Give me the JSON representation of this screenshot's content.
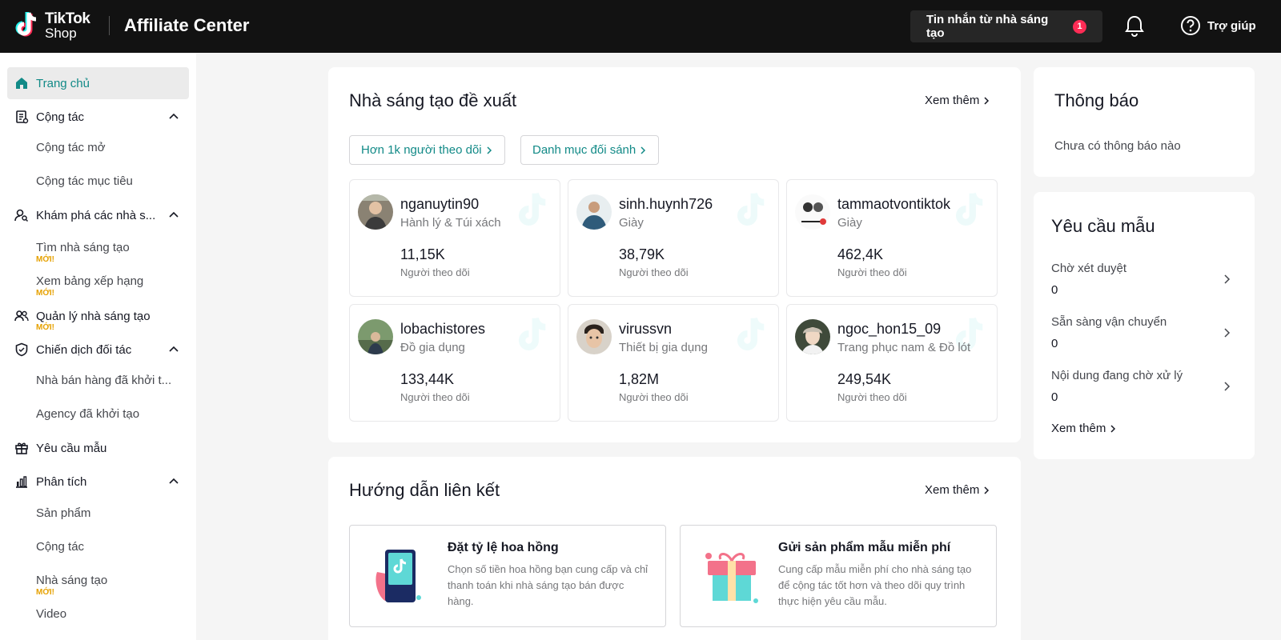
{
  "header": {
    "logo_line1": "TikTok",
    "logo_line2": "Shop",
    "app_title": "Affiliate Center",
    "messages_label": "Tin nhắn từ nhà sáng tạo",
    "messages_count": "1",
    "help_label": "Trợ giúp"
  },
  "sidebar": {
    "home": "Trang chủ",
    "collab": "Cộng tác",
    "collab_open": "Cộng tác mở",
    "collab_target": "Cộng tác mục tiêu",
    "discover": "Khám phá các nhà s...",
    "find_creators": "Tìm nhà sáng tạo",
    "view_ranking": "Xem bảng xếp hạng",
    "manage_creators": "Quản lý nhà sáng tạo",
    "partner_campaign": "Chiến dịch đối tác",
    "seller_initiated": "Nhà bán hàng đã khởi t...",
    "agency_initiated": "Agency đã khởi tạo",
    "sample_request": "Yêu cầu mẫu",
    "analytics": "Phân tích",
    "products": "Sản phẩm",
    "analytics_collab": "Cộng tác",
    "analytics_creators": "Nhà sáng tạo",
    "video": "Video",
    "new_tag": "MỚI!"
  },
  "suggested": {
    "title": "Nhà sáng tạo đề xuất",
    "see_more": "Xem thêm",
    "filter1": "Hơn 1k người theo dõi",
    "filter2": "Danh mục đối sánh",
    "follower_label": "Người theo dõi",
    "creators": [
      {
        "name": "nganuytin90",
        "category": "Hành lý & Túi xách",
        "followers": "11,15K"
      },
      {
        "name": "sinh.huynh726",
        "category": "Giày",
        "followers": "38,79K"
      },
      {
        "name": "tammaotvontiktok",
        "category": "Giày",
        "followers": "462,4K"
      },
      {
        "name": "lobachistores",
        "category": "Đồ gia dụng",
        "followers": "133,44K"
      },
      {
        "name": "virussvn",
        "category": "Thiết bị gia dụng",
        "followers": "1,82M"
      },
      {
        "name": "ngoc_hon15_09",
        "category": "Trang phục nam & Đồ lót",
        "followers": "249,54K"
      }
    ]
  },
  "guide": {
    "title": "Hướng dẫn liên kết",
    "see_more": "Xem thêm",
    "items": [
      {
        "title": "Đặt tỷ lệ hoa hồng",
        "desc": "Chọn số tiền hoa hồng bạn cung cấp và chỉ thanh toán khi nhà sáng tạo bán được hàng."
      },
      {
        "title": "Gửi sản phẩm mẫu miễn phí",
        "desc": "Cung cấp mẫu miễn phí cho nhà sáng tạo để cộng tác tốt hơn và theo dõi quy trình thực hiện yêu cầu mẫu."
      }
    ]
  },
  "notifications": {
    "title": "Thông báo",
    "empty": "Chưa có thông báo nào"
  },
  "samples": {
    "title": "Yêu cầu mẫu",
    "rows": [
      {
        "label": "Chờ xét duyệt",
        "value": "0"
      },
      {
        "label": "Sẵn sàng vận chuyển",
        "value": "0"
      },
      {
        "label": "Nội dung đang chờ xử lý",
        "value": "0"
      }
    ],
    "see_more": "Xem thêm"
  },
  "colors": {
    "accent": "#128a87",
    "header_bg": "#121212",
    "badge": "#fe2c55",
    "new_tag": "#e6a100"
  }
}
